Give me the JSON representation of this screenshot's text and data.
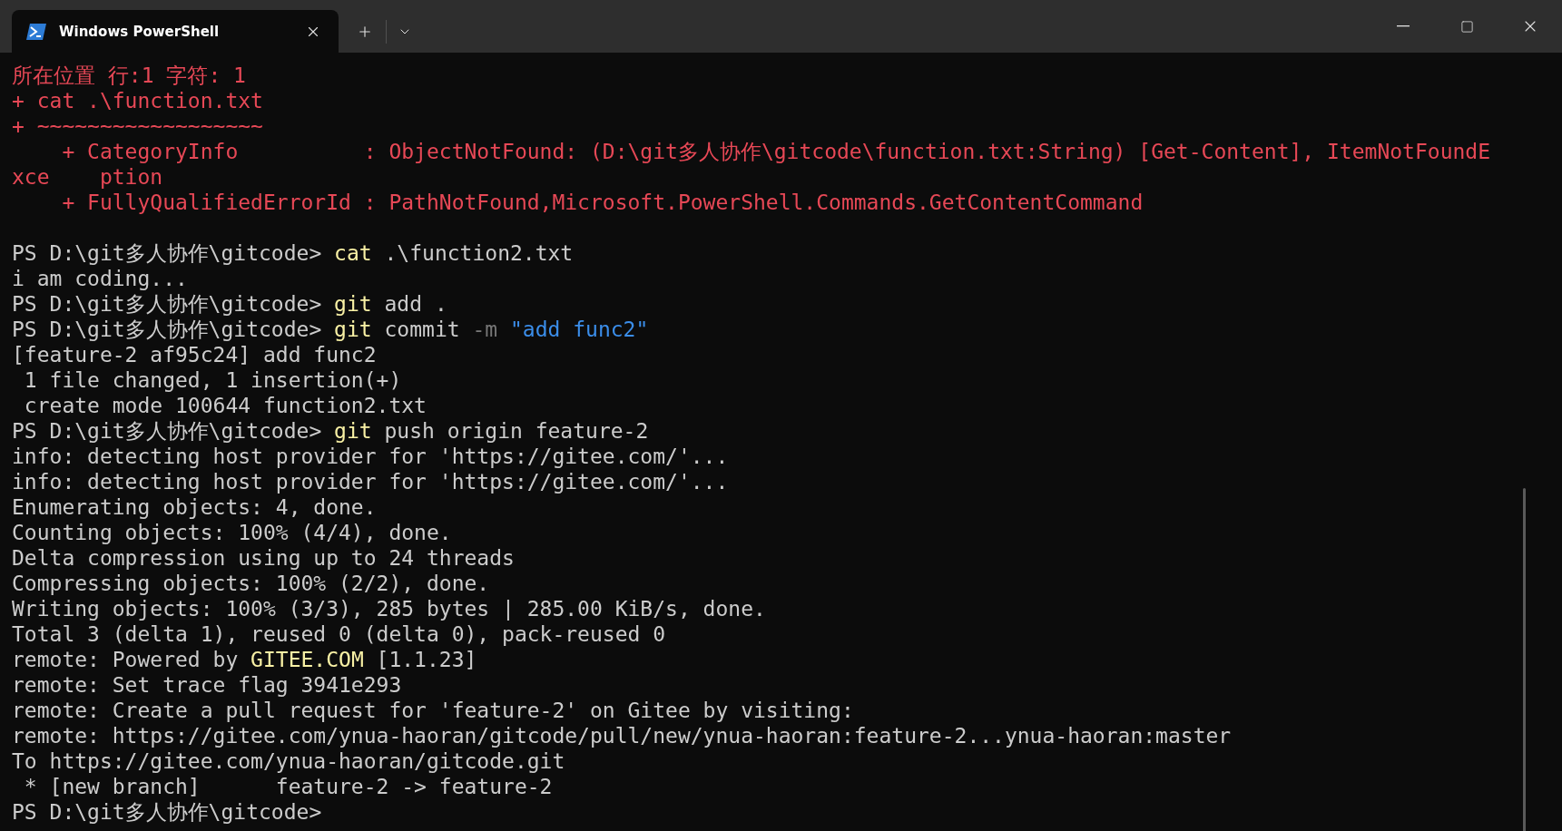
{
  "window": {
    "tabs": [
      {
        "title": "Windows PowerShell",
        "selected": true
      }
    ]
  },
  "terminal": {
    "lines": [
      {
        "kind": "text",
        "segments": [
          {
            "kind": "error",
            "text": "所在位置 行:1 字符: 1"
          }
        ]
      },
      {
        "kind": "text",
        "segments": [
          {
            "kind": "error",
            "text": "+ cat .\\function.txt"
          }
        ]
      },
      {
        "kind": "text",
        "segments": [
          {
            "kind": "error",
            "text": "+ ~~~~~~~~~~~~~~~~~~"
          }
        ]
      },
      {
        "kind": "text",
        "segments": [
          {
            "kind": "error",
            "text": "    + CategoryInfo          : ObjectNotFound: (D:\\git多人协作\\gitcode\\function.txt:String) [Get-Content], ItemNotFoundE"
          }
        ]
      },
      {
        "kind": "text",
        "segments": [
          {
            "kind": "error",
            "text": "xce    ption"
          }
        ]
      },
      {
        "kind": "text",
        "segments": [
          {
            "kind": "error",
            "text": "    + FullyQualifiedErrorId : PathNotFound,Microsoft.PowerShell.Commands.GetContentCommand"
          }
        ]
      },
      {
        "kind": "blank"
      },
      {
        "kind": "text",
        "segments": [
          {
            "kind": "plain",
            "text": "PS D:\\git多人协作\\gitcode> "
          },
          {
            "kind": "command",
            "text": "cat"
          },
          {
            "kind": "plain",
            "text": " .\\function2.txt"
          }
        ]
      },
      {
        "kind": "text",
        "segments": [
          {
            "kind": "plain",
            "text": "i am coding..."
          }
        ]
      },
      {
        "kind": "text",
        "segments": [
          {
            "kind": "plain",
            "text": "PS D:\\git多人协作\\gitcode> "
          },
          {
            "kind": "command",
            "text": "git"
          },
          {
            "kind": "plain",
            "text": " add ."
          }
        ]
      },
      {
        "kind": "text",
        "segments": [
          {
            "kind": "plain",
            "text": "PS D:\\git多人协作\\gitcode> "
          },
          {
            "kind": "command",
            "text": "git"
          },
          {
            "kind": "plain",
            "text": " commit "
          },
          {
            "kind": "flag",
            "text": "-m "
          },
          {
            "kind": "string",
            "text": "\"add func2\""
          }
        ]
      },
      {
        "kind": "text",
        "segments": [
          {
            "kind": "plain",
            "text": "[feature-2 af95c24] add func2"
          }
        ]
      },
      {
        "kind": "text",
        "segments": [
          {
            "kind": "plain",
            "text": " 1 file changed, 1 insertion(+)"
          }
        ]
      },
      {
        "kind": "text",
        "segments": [
          {
            "kind": "plain",
            "text": " create mode 100644 function2.txt"
          }
        ]
      },
      {
        "kind": "text",
        "segments": [
          {
            "kind": "plain",
            "text": "PS D:\\git多人协作\\gitcode> "
          },
          {
            "kind": "command",
            "text": "git"
          },
          {
            "kind": "plain",
            "text": " push origin feature-2"
          }
        ]
      },
      {
        "kind": "text",
        "segments": [
          {
            "kind": "plain",
            "text": "info: detecting host provider for 'https://gitee.com/'..."
          }
        ]
      },
      {
        "kind": "text",
        "segments": [
          {
            "kind": "plain",
            "text": "info: detecting host provider for 'https://gitee.com/'..."
          }
        ]
      },
      {
        "kind": "text",
        "segments": [
          {
            "kind": "plain",
            "text": "Enumerating objects: 4, done."
          }
        ]
      },
      {
        "kind": "text",
        "segments": [
          {
            "kind": "plain",
            "text": "Counting objects: 100% (4/4), done."
          }
        ]
      },
      {
        "kind": "text",
        "segments": [
          {
            "kind": "plain",
            "text": "Delta compression using up to 24 threads"
          }
        ]
      },
      {
        "kind": "text",
        "segments": [
          {
            "kind": "plain",
            "text": "Compressing objects: 100% (2/2), done."
          }
        ]
      },
      {
        "kind": "text",
        "segments": [
          {
            "kind": "plain",
            "text": "Writing objects: 100% (3/3), 285 bytes | 285.00 KiB/s, done."
          }
        ]
      },
      {
        "kind": "text",
        "segments": [
          {
            "kind": "plain",
            "text": "Total 3 (delta 1), reused 0 (delta 0), pack-reused 0"
          }
        ]
      },
      {
        "kind": "text",
        "segments": [
          {
            "kind": "plain",
            "text": "remote: Powered by "
          },
          {
            "kind": "command",
            "text": "GITEE.COM"
          },
          {
            "kind": "plain",
            "text": " [1.1.23]"
          }
        ]
      },
      {
        "kind": "text",
        "segments": [
          {
            "kind": "plain",
            "text": "remote: Set trace flag 3941e293"
          }
        ]
      },
      {
        "kind": "text",
        "segments": [
          {
            "kind": "plain",
            "text": "remote: Create a pull request for 'feature-2' on Gitee by visiting:"
          }
        ]
      },
      {
        "kind": "text",
        "segments": [
          {
            "kind": "plain",
            "text": "remote: https://gitee.com/ynua-haoran/gitcode/pull/new/ynua-haoran:feature-2...ynua-haoran:master"
          }
        ]
      },
      {
        "kind": "text",
        "segments": [
          {
            "kind": "plain",
            "text": "To https://gitee.com/ynua-haoran/gitcode.git"
          }
        ]
      },
      {
        "kind": "text",
        "segments": [
          {
            "kind": "plain",
            "text": " * [new branch]      feature-2 -> feature-2"
          }
        ]
      },
      {
        "kind": "text",
        "segments": [
          {
            "kind": "plain",
            "text": "PS D:\\git多人协作\\gitcode>"
          }
        ]
      }
    ]
  }
}
